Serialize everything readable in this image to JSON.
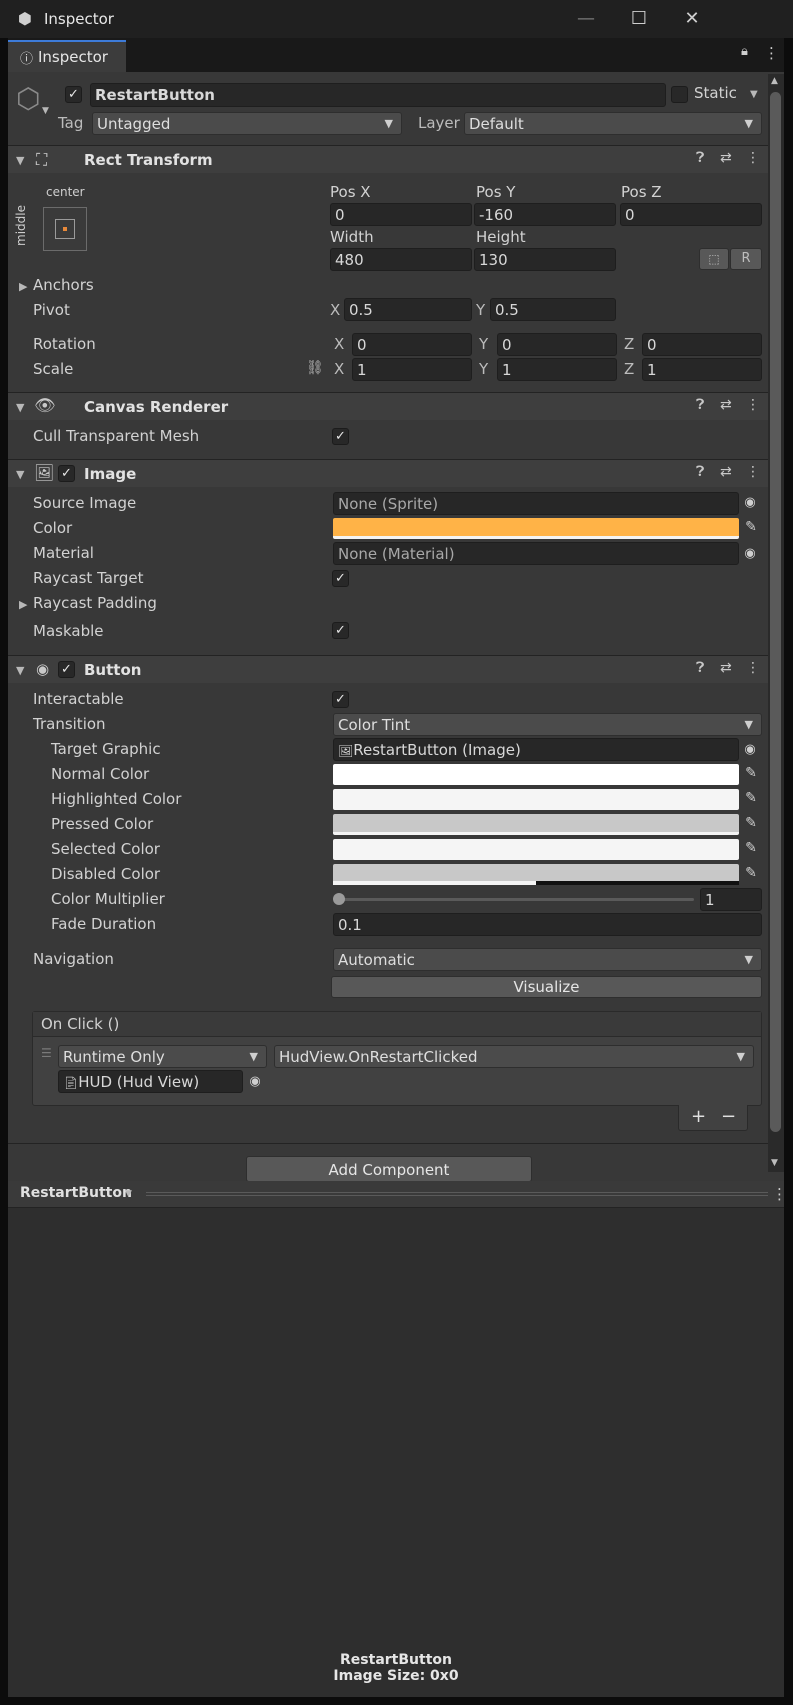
{
  "window": {
    "title": "Inspector",
    "minimize": "—",
    "maximize": "☐",
    "close": "✕"
  },
  "tab": {
    "label": "Inspector"
  },
  "header": {
    "object_name": "RestartButton",
    "active_checked": true,
    "static_label": "Static",
    "tag_label": "Tag",
    "tag_value": "Untagged",
    "layer_label": "Layer",
    "layer_value": "Default"
  },
  "rect_transform": {
    "title": "Rect Transform",
    "anchor_top_label": "center",
    "anchor_side_label": "middle",
    "pos_x_label": "Pos X",
    "pos_x": "0",
    "pos_y_label": "Pos Y",
    "pos_y": "-160",
    "pos_z_label": "Pos Z",
    "pos_z": "0",
    "width_label": "Width",
    "width": "480",
    "height_label": "Height",
    "height": "130",
    "r_button": "R",
    "anchors_label": "Anchors",
    "pivot_label": "Pivot",
    "pivot_x": "0.5",
    "pivot_y": "0.5",
    "rotation_label": "Rotation",
    "rot_x": "0",
    "rot_y": "0",
    "rot_z": "0",
    "scale_label": "Scale",
    "scale_x": "1",
    "scale_y": "1",
    "scale_z": "1",
    "x": "X",
    "y": "Y",
    "z": "Z"
  },
  "canvas_renderer": {
    "title": "Canvas Renderer",
    "cull_label": "Cull Transparent Mesh",
    "cull_checked": true
  },
  "image": {
    "title": "Image",
    "source_label": "Source Image",
    "source_value": "None (Sprite)",
    "color_label": "Color",
    "color_hex": "#ffb347",
    "material_label": "Material",
    "material_value": "None (Material)",
    "raycast_label": "Raycast Target",
    "raycast_padding_label": "Raycast Padding",
    "maskable_label": "Maskable"
  },
  "button": {
    "title": "Button",
    "interactable_label": "Interactable",
    "transition_label": "Transition",
    "transition_value": "Color Tint",
    "target_label": "Target Graphic",
    "target_value": "RestartButton (Image)",
    "normal_label": "Normal Color",
    "normal_hex": "#ffffff",
    "highlighted_label": "Highlighted Color",
    "highlighted_hex": "#f5f5f5",
    "pressed_label": "Pressed Color",
    "pressed_hex": "#c8c8c8",
    "selected_label": "Selected Color",
    "selected_hex": "#f5f5f5",
    "disabled_label": "Disabled Color",
    "disabled_hex": "#c8c8c8",
    "multiplier_label": "Color Multiplier",
    "multiplier_value": "1",
    "fade_label": "Fade Duration",
    "fade_value": "0.1",
    "navigation_label": "Navigation",
    "navigation_value": "Automatic",
    "visualize_label": "Visualize"
  },
  "onclick": {
    "title": "On Click ()",
    "runtime_value": "Runtime Only",
    "function_value": "HudView.OnRestartClicked",
    "object_value": "HUD (Hud View)",
    "add_label": "+",
    "remove_label": "−"
  },
  "add_component_label": "Add Component",
  "preview": {
    "dropdown_label": "RestartButton",
    "name": "RestartButton",
    "size": "Image Size: 0x0"
  }
}
